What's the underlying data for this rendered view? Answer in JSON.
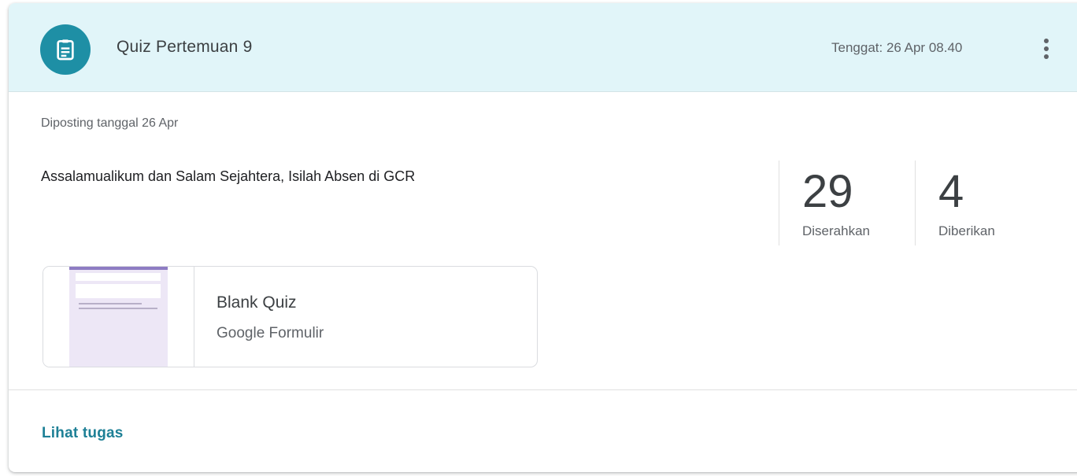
{
  "header": {
    "icon": "assignment-icon",
    "title": "Quiz Pertemuan 9",
    "due": "Tenggat: 26 Apr 08.40",
    "more_icon": "more-vert-icon"
  },
  "body": {
    "posted": "Diposting tanggal 26 Apr",
    "description": "Assalamualikum dan Salam Sejahtera, Isilah Absen di GCR"
  },
  "stats": [
    {
      "value": "29",
      "label": "Diserahkan"
    },
    {
      "value": "4",
      "label": "Diberikan"
    }
  ],
  "attachment": {
    "thumbnail": "form-thumbnail",
    "title": "Blank Quiz",
    "subtitle": "Google Formulir"
  },
  "footer": {
    "link_label": "Lihat tugas"
  },
  "colors": {
    "header_bg": "#e1f5f9",
    "accent": "#1e8fa5",
    "link": "#1e8096"
  }
}
